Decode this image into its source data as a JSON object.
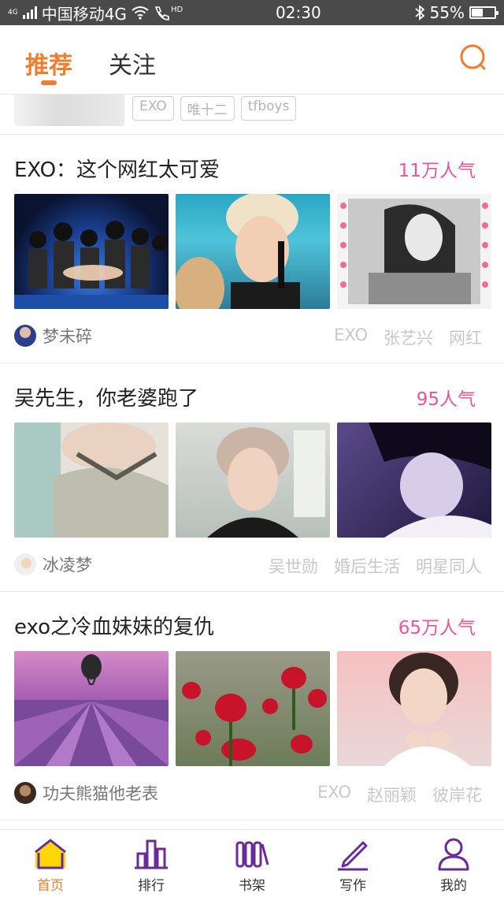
{
  "status": {
    "network_small": "4G",
    "carrier": "中国移动4G",
    "hd": "HD",
    "time": "02:30",
    "battery": "55%",
    "battery_level": 0.55
  },
  "header": {
    "tabs": [
      {
        "label": "推荐",
        "active": true
      },
      {
        "label": "关注",
        "active": false
      }
    ],
    "accent_color": "#f07d2e"
  },
  "previous_card_tags": [
    "EXO",
    "唯十二",
    "tfboys"
  ],
  "cards": [
    {
      "title": "EXO：这个网红太可爱",
      "popularity": "11万人气",
      "author": "梦未碎",
      "tags": [
        "EXO",
        "张艺兴",
        "网红"
      ]
    },
    {
      "title": "吴先生，你老婆跑了",
      "popularity": "95人气",
      "author": "冰凌梦",
      "tags": [
        "吴世勋",
        "婚后生活",
        "明星同人"
      ]
    },
    {
      "title": "exo之冷血妹妹的复仇",
      "popularity": "65万人气",
      "author": "功夫熊猫他老表",
      "tags": [
        "EXO",
        "赵丽颖",
        "彼岸花"
      ]
    }
  ],
  "bottom_nav": [
    {
      "label": "首页",
      "icon": "home-icon",
      "active": true
    },
    {
      "label": "排行",
      "icon": "ranking-icon",
      "active": false
    },
    {
      "label": "书架",
      "icon": "bookshelf-icon",
      "active": false
    },
    {
      "label": "写作",
      "icon": "pen-icon",
      "active": false
    },
    {
      "label": "我的",
      "icon": "person-icon",
      "active": false
    }
  ],
  "colors": {
    "popularity": "#e8559a",
    "nav_icon": "#6a2a9a",
    "home_fill": "#ffd700"
  }
}
